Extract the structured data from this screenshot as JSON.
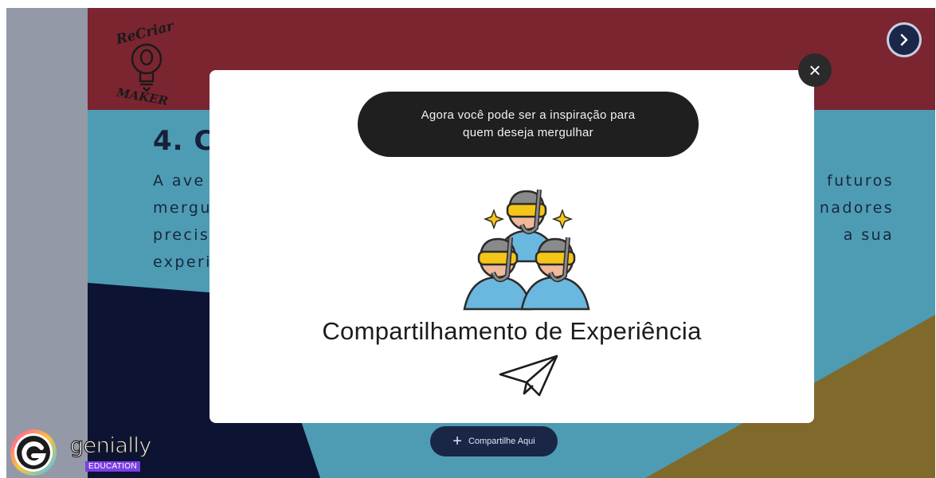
{
  "slide": {
    "logo_top_text": "ReCriar",
    "logo_bottom_text": "MAKER",
    "title_visible": "4. C",
    "body_lines": [
      {
        "left": "A  ave",
        "right": "futuros"
      },
      {
        "left": "mergu",
        "right": "nadores"
      },
      {
        "left": "precis",
        "right": "a  sua"
      },
      {
        "left": "experi",
        "right": ""
      }
    ],
    "next_icon": "chevron-right-icon",
    "share_button": {
      "icon": "plus-icon",
      "label": "Compartilhe Aqui"
    }
  },
  "modal": {
    "close_symbol": "×",
    "tooltip_line1": "Agora você pode ser a inspiração para",
    "tooltip_line2": "quem deseja mergulhar",
    "illustration": "snorkel-divers-icon",
    "title": "Compartilhamento de Experiência",
    "action_icon": "paper-plane-icon"
  },
  "badge": {
    "brand": "genially",
    "sub": "EDUCATION"
  },
  "colors": {
    "header": "#7b2530",
    "sea": "#4e9cb3",
    "navy": "#0c1333",
    "mustard": "#7f6a2c",
    "modal_bg": "#ffffff",
    "tooltip_bg": "#1f1f1f"
  }
}
